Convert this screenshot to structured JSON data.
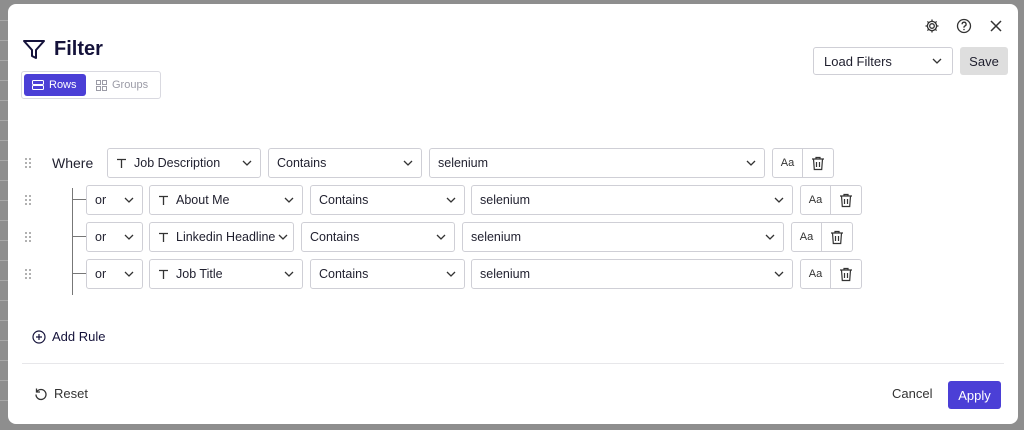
{
  "title": "Filter",
  "tabs": {
    "rows": "Rows",
    "groups": "Groups"
  },
  "load_filters": "Load Filters",
  "save": "Save",
  "where": "Where",
  "rules": [
    {
      "field": "Job Description",
      "operator": "Contains",
      "value": "selenium"
    },
    {
      "conj": "or",
      "field": "About Me",
      "operator": "Contains",
      "value": "selenium"
    },
    {
      "conj": "or",
      "field": "Linkedin Headline",
      "operator": "Contains",
      "value": "selenium"
    },
    {
      "conj": "or",
      "field": "Job Title",
      "operator": "Contains",
      "value": "selenium"
    }
  ],
  "case_toggle": "Aa",
  "add_rule": "Add Rule",
  "reset": "Reset",
  "cancel": "Cancel",
  "apply": "Apply",
  "colors": {
    "accent": "#4b3fd6",
    "title": "#14123a"
  }
}
